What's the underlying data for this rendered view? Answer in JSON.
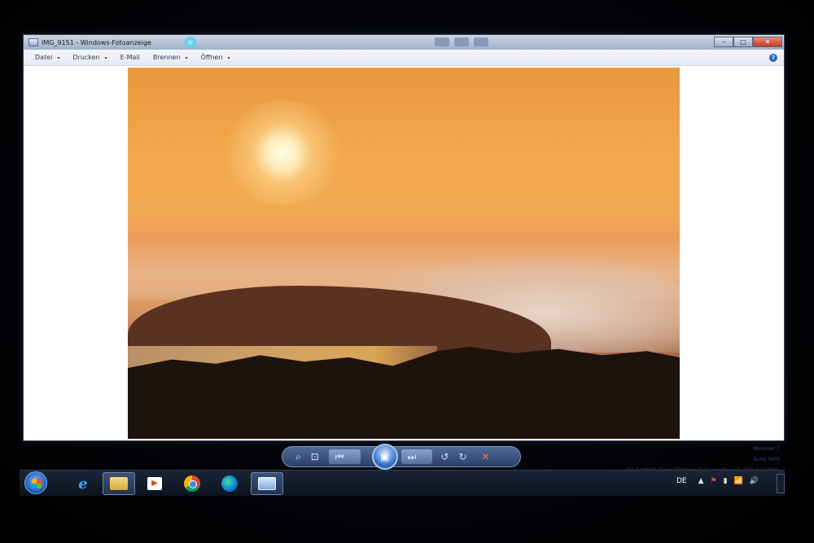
{
  "window": {
    "title": "IMG_9151 - Windows-Fotoanzeige",
    "min": "–",
    "max": "□",
    "close": "✕"
  },
  "menu": {
    "items": [
      {
        "label": "Datei",
        "caret": "▾"
      },
      {
        "label": "Drucken",
        "caret": "▾"
      },
      {
        "label": "E-Mail",
        "caret": ""
      },
      {
        "label": "Brennen",
        "caret": "▾"
      },
      {
        "label": "Öffnen",
        "caret": "▾"
      }
    ],
    "help": "?"
  },
  "controls": {
    "zoom": "⌕",
    "fit": "⊡",
    "prev": "⏮",
    "slideshow": "▣",
    "next": "⏭",
    "rotate_left": "↺",
    "rotate_right": "↻",
    "delete": "✕"
  },
  "watermark": {
    "line1": "Windows 7",
    "line2": "Build 7600",
    "line3": "Die Echtheit dieser Windows-Kopie wurde noch nicht bestätigt."
  },
  "taskbar": {
    "ie": "e",
    "media": "▶",
    "language": "DE",
    "tray_up": "▲",
    "tray_flag": "⚑",
    "tray_power": "▮",
    "tray_network": "📶",
    "tray_volume": "🔊"
  },
  "colors": {
    "titlebar": "#9fb0c9",
    "taskbar": "#0d1420",
    "accent": "#3a78c9"
  }
}
